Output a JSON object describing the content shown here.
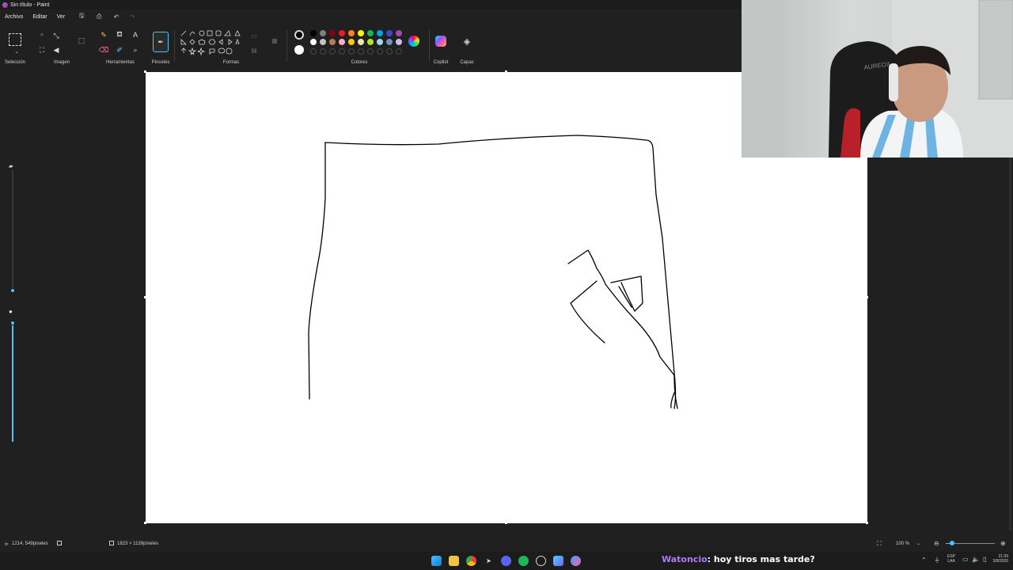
{
  "window": {
    "title": "Sin título - Paint"
  },
  "menu": {
    "items": [
      "Archivo",
      "Editar",
      "Ver"
    ]
  },
  "ribbon": {
    "groups": {
      "selection": "Selección",
      "image": "Imagen",
      "tools": "Herramientas",
      "brushes": "Pinceles",
      "shapes": "Formas",
      "colors": "Colores",
      "copilot": "Copilot",
      "layers": "Capas"
    },
    "palette_row1": [
      "#000000",
      "#7f7f7f",
      "#880015",
      "#ed1c24",
      "#ff7f27",
      "#fff200",
      "#22b14c",
      "#00a2e8",
      "#3f48cc",
      "#a349a4"
    ],
    "palette_row2": [
      "#ffffff",
      "#c3c3c3",
      "#b97a57",
      "#ffaec9",
      "#ffc90e",
      "#efe4b0",
      "#b5e61d",
      "#99d9ea",
      "#7092be",
      "#c8bfe7"
    ],
    "primary_color": "#000000",
    "secondary_color": "#ffffff"
  },
  "status": {
    "cursor_position": "1214, 549píxeles",
    "canvas_size": "1823 × 1139píxeles",
    "zoom": "100 %"
  },
  "taskbar": {
    "lang_top": "ESP",
    "lang_bottom": "LAA",
    "time": "21:39",
    "date": "3/8/2026"
  },
  "chat": {
    "username": "Watoncio",
    "message": ": hoy tiros mas tarde?"
  },
  "webcam": {
    "chair_brand": "AUREOX"
  }
}
